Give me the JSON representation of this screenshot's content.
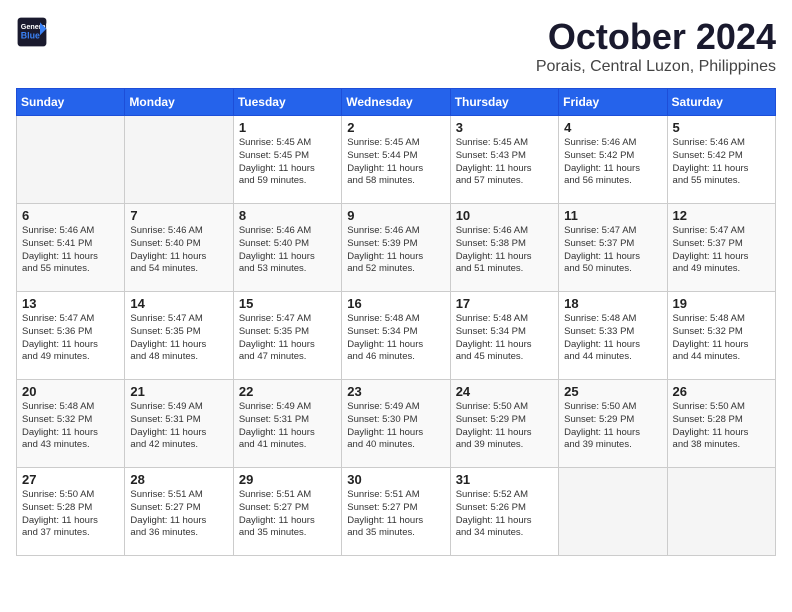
{
  "header": {
    "logo_line1": "General",
    "logo_line2": "Blue",
    "month": "October 2024",
    "location": "Porais, Central Luzon, Philippines"
  },
  "days_of_week": [
    "Sunday",
    "Monday",
    "Tuesday",
    "Wednesday",
    "Thursday",
    "Friday",
    "Saturday"
  ],
  "weeks": [
    [
      {
        "day": "",
        "info": ""
      },
      {
        "day": "",
        "info": ""
      },
      {
        "day": "1",
        "info": "Sunrise: 5:45 AM\nSunset: 5:45 PM\nDaylight: 11 hours\nand 59 minutes."
      },
      {
        "day": "2",
        "info": "Sunrise: 5:45 AM\nSunset: 5:44 PM\nDaylight: 11 hours\nand 58 minutes."
      },
      {
        "day": "3",
        "info": "Sunrise: 5:45 AM\nSunset: 5:43 PM\nDaylight: 11 hours\nand 57 minutes."
      },
      {
        "day": "4",
        "info": "Sunrise: 5:46 AM\nSunset: 5:42 PM\nDaylight: 11 hours\nand 56 minutes."
      },
      {
        "day": "5",
        "info": "Sunrise: 5:46 AM\nSunset: 5:42 PM\nDaylight: 11 hours\nand 55 minutes."
      }
    ],
    [
      {
        "day": "6",
        "info": "Sunrise: 5:46 AM\nSunset: 5:41 PM\nDaylight: 11 hours\nand 55 minutes."
      },
      {
        "day": "7",
        "info": "Sunrise: 5:46 AM\nSunset: 5:40 PM\nDaylight: 11 hours\nand 54 minutes."
      },
      {
        "day": "8",
        "info": "Sunrise: 5:46 AM\nSunset: 5:40 PM\nDaylight: 11 hours\nand 53 minutes."
      },
      {
        "day": "9",
        "info": "Sunrise: 5:46 AM\nSunset: 5:39 PM\nDaylight: 11 hours\nand 52 minutes."
      },
      {
        "day": "10",
        "info": "Sunrise: 5:46 AM\nSunset: 5:38 PM\nDaylight: 11 hours\nand 51 minutes."
      },
      {
        "day": "11",
        "info": "Sunrise: 5:47 AM\nSunset: 5:37 PM\nDaylight: 11 hours\nand 50 minutes."
      },
      {
        "day": "12",
        "info": "Sunrise: 5:47 AM\nSunset: 5:37 PM\nDaylight: 11 hours\nand 49 minutes."
      }
    ],
    [
      {
        "day": "13",
        "info": "Sunrise: 5:47 AM\nSunset: 5:36 PM\nDaylight: 11 hours\nand 49 minutes."
      },
      {
        "day": "14",
        "info": "Sunrise: 5:47 AM\nSunset: 5:35 PM\nDaylight: 11 hours\nand 48 minutes."
      },
      {
        "day": "15",
        "info": "Sunrise: 5:47 AM\nSunset: 5:35 PM\nDaylight: 11 hours\nand 47 minutes."
      },
      {
        "day": "16",
        "info": "Sunrise: 5:48 AM\nSunset: 5:34 PM\nDaylight: 11 hours\nand 46 minutes."
      },
      {
        "day": "17",
        "info": "Sunrise: 5:48 AM\nSunset: 5:34 PM\nDaylight: 11 hours\nand 45 minutes."
      },
      {
        "day": "18",
        "info": "Sunrise: 5:48 AM\nSunset: 5:33 PM\nDaylight: 11 hours\nand 44 minutes."
      },
      {
        "day": "19",
        "info": "Sunrise: 5:48 AM\nSunset: 5:32 PM\nDaylight: 11 hours\nand 44 minutes."
      }
    ],
    [
      {
        "day": "20",
        "info": "Sunrise: 5:48 AM\nSunset: 5:32 PM\nDaylight: 11 hours\nand 43 minutes."
      },
      {
        "day": "21",
        "info": "Sunrise: 5:49 AM\nSunset: 5:31 PM\nDaylight: 11 hours\nand 42 minutes."
      },
      {
        "day": "22",
        "info": "Sunrise: 5:49 AM\nSunset: 5:31 PM\nDaylight: 11 hours\nand 41 minutes."
      },
      {
        "day": "23",
        "info": "Sunrise: 5:49 AM\nSunset: 5:30 PM\nDaylight: 11 hours\nand 40 minutes."
      },
      {
        "day": "24",
        "info": "Sunrise: 5:50 AM\nSunset: 5:29 PM\nDaylight: 11 hours\nand 39 minutes."
      },
      {
        "day": "25",
        "info": "Sunrise: 5:50 AM\nSunset: 5:29 PM\nDaylight: 11 hours\nand 39 minutes."
      },
      {
        "day": "26",
        "info": "Sunrise: 5:50 AM\nSunset: 5:28 PM\nDaylight: 11 hours\nand 38 minutes."
      }
    ],
    [
      {
        "day": "27",
        "info": "Sunrise: 5:50 AM\nSunset: 5:28 PM\nDaylight: 11 hours\nand 37 minutes."
      },
      {
        "day": "28",
        "info": "Sunrise: 5:51 AM\nSunset: 5:27 PM\nDaylight: 11 hours\nand 36 minutes."
      },
      {
        "day": "29",
        "info": "Sunrise: 5:51 AM\nSunset: 5:27 PM\nDaylight: 11 hours\nand 35 minutes."
      },
      {
        "day": "30",
        "info": "Sunrise: 5:51 AM\nSunset: 5:27 PM\nDaylight: 11 hours\nand 35 minutes."
      },
      {
        "day": "31",
        "info": "Sunrise: 5:52 AM\nSunset: 5:26 PM\nDaylight: 11 hours\nand 34 minutes."
      },
      {
        "day": "",
        "info": ""
      },
      {
        "day": "",
        "info": ""
      }
    ]
  ]
}
